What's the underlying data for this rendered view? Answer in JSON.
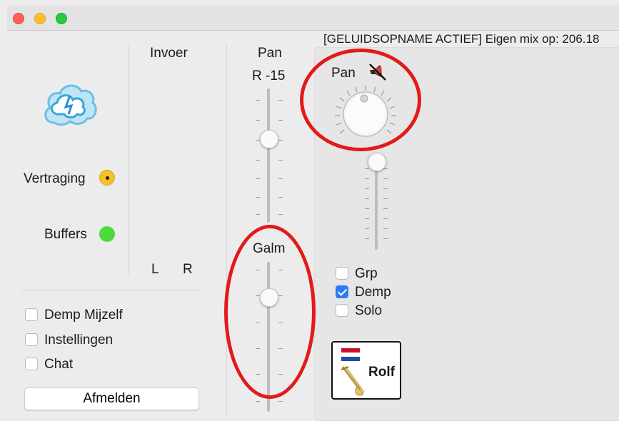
{
  "window": {
    "status_text": "[GELUIDSOPNAME ACTIEF] Eigen mix op: 206.18"
  },
  "left_panel": {
    "delay_label": "Vertraging",
    "buffers_label": "Buffers",
    "delay_status_color": "#f5c02a",
    "buffers_status_color": "#4cdb3a",
    "options": [
      {
        "label": "Demp Mijzelf",
        "checked": false
      },
      {
        "label": "Instellingen",
        "checked": false
      },
      {
        "label": "Chat",
        "checked": false
      }
    ],
    "logout_label": "Afmelden"
  },
  "input_section": {
    "title": "Invoer",
    "left_label": "L",
    "right_label": "R"
  },
  "pan_section": {
    "title": "Pan",
    "value_label": "R -15",
    "reverb_label": "Galm"
  },
  "channel": {
    "pan_label": "Pan",
    "checkboxes": [
      {
        "label": "Grp",
        "checked": false
      },
      {
        "label": "Demp",
        "checked": true
      },
      {
        "label": "Solo",
        "checked": false
      }
    ],
    "name": "Rolf",
    "flag": "netherlands",
    "instrument_icon": "trombone-icon"
  },
  "highlight_color": "#e31a1a"
}
